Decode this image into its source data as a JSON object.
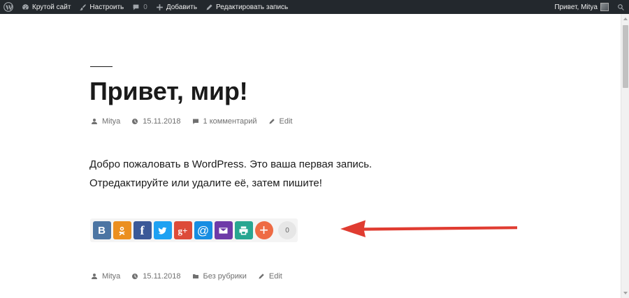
{
  "admin_bar": {
    "site_name": "Крутой сайт",
    "customize": "Настроить",
    "comments_count": "0",
    "new": "Добавить",
    "edit_post": "Редактировать запись",
    "greeting": "Привет, Mitya"
  },
  "post": {
    "title": "Привет, мир!",
    "meta_top": {
      "author": "Mitya",
      "date": "15.11.2018",
      "comments": "1 комментарий",
      "edit": "Edit"
    },
    "body": [
      "Добро пожаловать в WordPress. Это ваша первая запись.",
      "Отредактируйте или удалите её, затем пишите!"
    ],
    "meta_bottom": {
      "author": "Mitya",
      "date": "15.11.2018",
      "category": "Без рубрики",
      "edit": "Edit"
    }
  },
  "share": {
    "buttons": [
      {
        "icon": "vk-icon",
        "glyph": "В",
        "color": "#4c75a3"
      },
      {
        "icon": "odnoklassniki-icon",
        "glyph": "",
        "color": "#eb8f20"
      },
      {
        "icon": "facebook-icon",
        "glyph": "f",
        "color": "#3b5998"
      },
      {
        "icon": "twitter-icon",
        "glyph": "",
        "color": "#1da1f2"
      },
      {
        "icon": "google-plus-icon",
        "glyph": "g+",
        "color": "#dd4b39"
      },
      {
        "icon": "mail-ru-icon",
        "glyph": "@",
        "color": "#168de2"
      },
      {
        "icon": "email-icon",
        "glyph": "",
        "color": "#6e3aa8"
      },
      {
        "icon": "print-icon",
        "glyph": "",
        "color": "#28a691"
      },
      {
        "icon": "more-icon",
        "glyph": "+",
        "color": "#ee6b44"
      }
    ],
    "count": "0"
  },
  "annotation": {
    "arrow_color": "#e03c31"
  }
}
